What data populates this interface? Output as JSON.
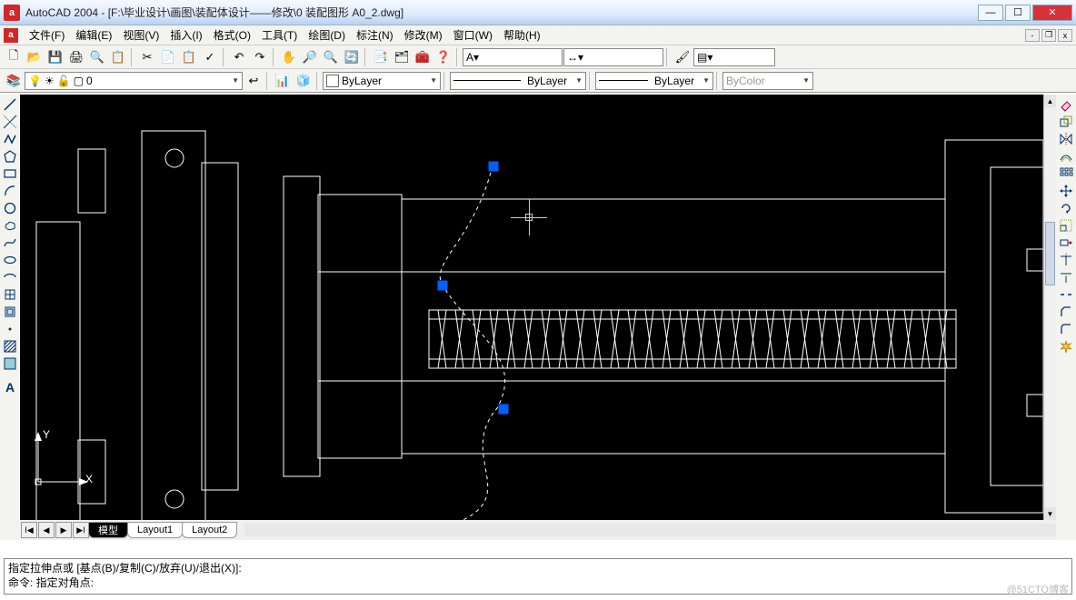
{
  "title": "AutoCAD 2004 - [F:\\毕业设计\\画图\\装配体设计——修改\\0 装配图形 A0_2.dwg]",
  "menu": [
    "文件(F)",
    "编辑(E)",
    "视图(V)",
    "插入(I)",
    "格式(O)",
    "工具(T)",
    "绘图(D)",
    "标注(N)",
    "修改(M)",
    "窗口(W)",
    "帮助(H)"
  ],
  "layer": {
    "current": "0"
  },
  "props": {
    "color_label": "ByLayer",
    "linetype_label": "ByLayer",
    "lineweight_label": "ByLayer",
    "plotstyle_label": "ByColor"
  },
  "tabs": {
    "active": "模型",
    "list": [
      "模型",
      "Layout1",
      "Layout2"
    ]
  },
  "cmd": {
    "line1": "指定拉伸点或 [基点(B)/复制(C)/放弃(U)/退出(X)]:",
    "line2": "命令:   指定对角点:"
  },
  "watermark": "@51CTO博客",
  "ucs": {
    "y": "Y",
    "x": "X"
  }
}
